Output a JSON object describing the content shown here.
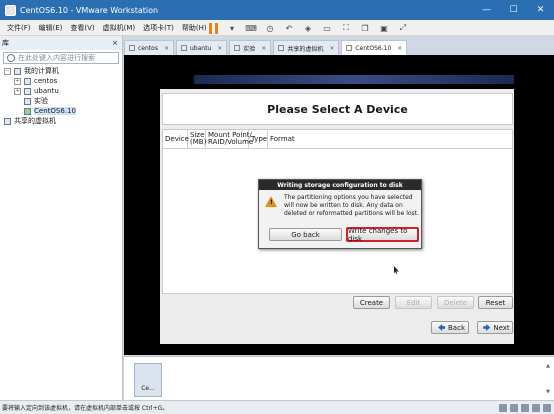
{
  "window": {
    "title": "CentOS6.10 - VMware Workstation",
    "minimize": "—",
    "maximize": "☐",
    "close": "✕"
  },
  "menu": [
    "文件(F)",
    "编辑(E)",
    "查看(V)",
    "虚拟机(M)",
    "选项卡(T)",
    "帮助(H)"
  ],
  "sidebar": {
    "header": "库",
    "close": "×",
    "search_placeholder": "在此处键入内容进行搜索",
    "tree": {
      "root": "我的计算机",
      "items": [
        "centos",
        "ubantu",
        "实验",
        "CentOS6.10"
      ],
      "shared": "共享的虚拟机"
    }
  },
  "tabs": [
    "centos",
    "ubantu",
    "实验",
    "共享的虚拟机",
    "CentOS6.10"
  ],
  "installer": {
    "title": "Please Select A Device",
    "columns": [
      "Device",
      "Size (MB)",
      "Mount Point/ RAID/Volume",
      "Type",
      "Format"
    ],
    "buttons": {
      "create": "Create",
      "edit": "Edit",
      "delete": "Delete",
      "reset": "Reset",
      "back": "Back",
      "next": "Next"
    }
  },
  "dialog": {
    "title": "Writing storage configuration to disk",
    "message": "The partitioning options you have selected will now be written to disk.  Any data on deleted or reformatted partitions will be lost.",
    "go_back": "Go back",
    "write": "Write changes to disk"
  },
  "thumbnail": "Ce...",
  "statusbar": "要将输入定向到该虚拟机，请在虚拟机内部单击或按 Ctrl+G。"
}
